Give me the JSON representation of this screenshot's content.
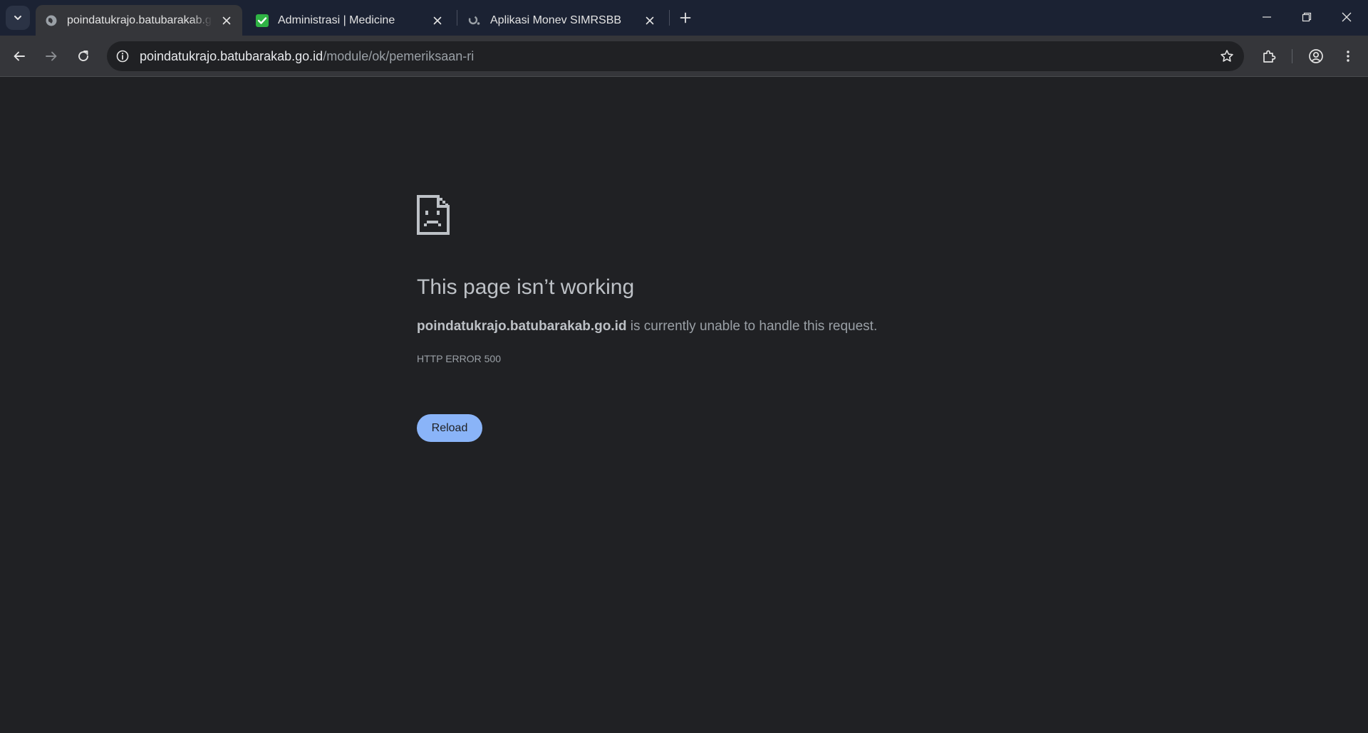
{
  "browser": {
    "tabs": [
      {
        "title": "poindatukrajo.batubarakab.go.id",
        "active": true,
        "favicon": "globe-icon"
      },
      {
        "title": "Administrasi | Medicine",
        "active": false,
        "favicon": "green-shield-check-icon"
      },
      {
        "title": "Aplikasi Monev SIMRSBB",
        "active": false,
        "favicon": "loading-favicon-icon"
      }
    ],
    "address_bar": {
      "host": "poindatukrajo.batubarakab.go.id",
      "path": "/module/ok/pemeriksaan-ri"
    }
  },
  "error_page": {
    "icon": "sad-document-icon",
    "title": "This page isn’t working",
    "host": "poindatukrajo.batubarakab.go.id",
    "message": " is currently unable to handle this request.",
    "error_code": "HTTP ERROR 500",
    "reload_label": "Reload"
  },
  "colors": {
    "tabstrip_bg": "#1b2233",
    "toolbar_bg": "#35363a",
    "page_bg": "#202124",
    "accent": "#8ab4f8"
  }
}
